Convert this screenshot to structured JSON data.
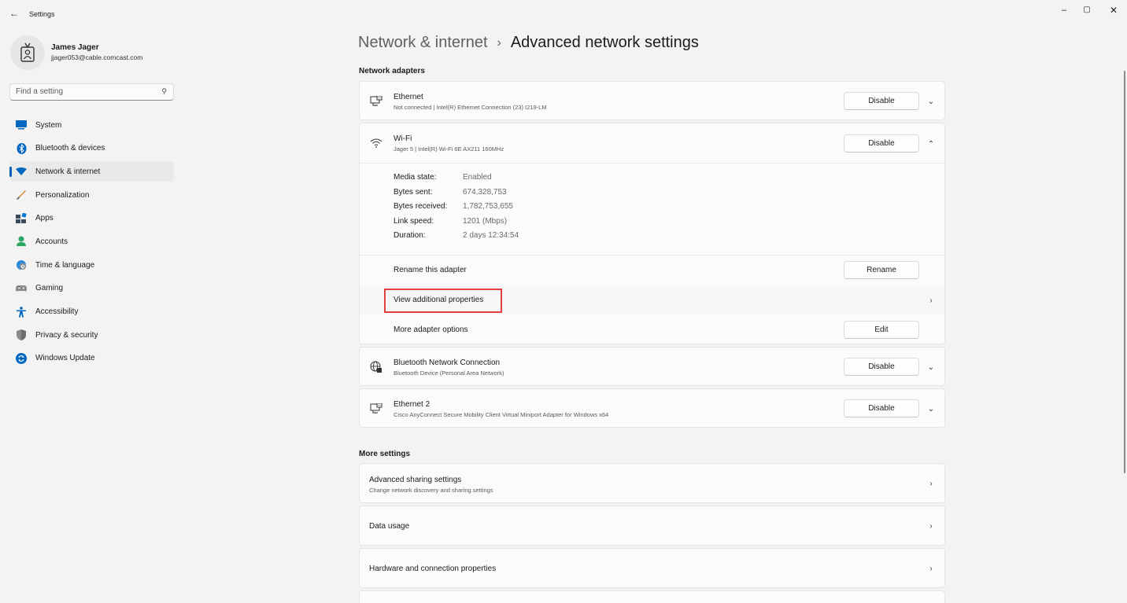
{
  "window": {
    "title": "Settings",
    "back_glyph": "←",
    "minimize_glyph": "–",
    "maximize_glyph": "▢",
    "close_glyph": "✕"
  },
  "profile": {
    "name": "James Jager",
    "email": "jjager053@cable.comcast.com"
  },
  "search": {
    "placeholder": "Find a setting",
    "icon": "search-icon"
  },
  "sidebar": {
    "items": [
      {
        "label": "System",
        "icon": "system-icon",
        "active": false
      },
      {
        "label": "Bluetooth & devices",
        "icon": "bluetooth-icon",
        "active": false
      },
      {
        "label": "Network & internet",
        "icon": "network-icon",
        "active": true
      },
      {
        "label": "Personalization",
        "icon": "brush-icon",
        "active": false
      },
      {
        "label": "Apps",
        "icon": "apps-icon",
        "active": false
      },
      {
        "label": "Accounts",
        "icon": "accounts-icon",
        "active": false
      },
      {
        "label": "Time & language",
        "icon": "globe-clock-icon",
        "active": false
      },
      {
        "label": "Gaming",
        "icon": "gamepad-icon",
        "active": false
      },
      {
        "label": "Accessibility",
        "icon": "accessibility-icon",
        "active": false
      },
      {
        "label": "Privacy & security",
        "icon": "shield-icon",
        "active": false
      },
      {
        "label": "Windows Update",
        "icon": "update-icon",
        "active": false
      }
    ]
  },
  "breadcrumb": {
    "parent": "Network & internet",
    "separator": "›",
    "current": "Advanced network settings"
  },
  "adapters_section": {
    "title": "Network adapters",
    "adapters": [
      {
        "name": "Ethernet",
        "detail": "Not connected | Intel(R) Ethernet Connection (23) I219-LM",
        "button": "Disable",
        "expanded": false,
        "icon": "ethernet-icon"
      },
      {
        "name": "Wi-Fi",
        "detail": "Jager 5 | Intel(R) Wi-Fi 6E AX211 160MHz",
        "button": "Disable",
        "expanded": true,
        "icon": "wifi-icon"
      },
      {
        "name": "Bluetooth Network Connection",
        "detail": "Bluetooth Device (Personal Area Network)",
        "button": "Disable",
        "expanded": false,
        "icon": "globe-network-icon"
      },
      {
        "name": "Ethernet 2",
        "detail": "Cisco AnyConnect Secure Mobility Client Virtual Miniport Adapter for Windows x64",
        "button": "Disable",
        "expanded": false,
        "icon": "ethernet-icon"
      }
    ],
    "wifi_details": {
      "properties": [
        {
          "label": "Media state:",
          "value": "Enabled"
        },
        {
          "label": "Bytes sent:",
          "value": "674,328,753"
        },
        {
          "label": "Bytes received:",
          "value": "1,782,753,655"
        },
        {
          "label": "Link speed:",
          "value": "1201 (Mbps)"
        },
        {
          "label": "Duration:",
          "value": "2 days 12:34:54"
        }
      ],
      "rename_label": "Rename this adapter",
      "rename_button": "Rename",
      "view_props_label": "View additional properties",
      "more_options_label": "More adapter options",
      "edit_button": "Edit"
    }
  },
  "more_settings": {
    "title": "More settings",
    "items": [
      {
        "title": "Advanced sharing settings",
        "subtitle": "Change network discovery and sharing settings"
      },
      {
        "title": "Data usage",
        "subtitle": ""
      },
      {
        "title": "Hardware and connection properties",
        "subtitle": ""
      }
    ]
  },
  "colors": {
    "accent": "#005fb8",
    "highlight_box": "#e04040",
    "background": "#f3f3f3",
    "card": "#fbfbfb"
  }
}
